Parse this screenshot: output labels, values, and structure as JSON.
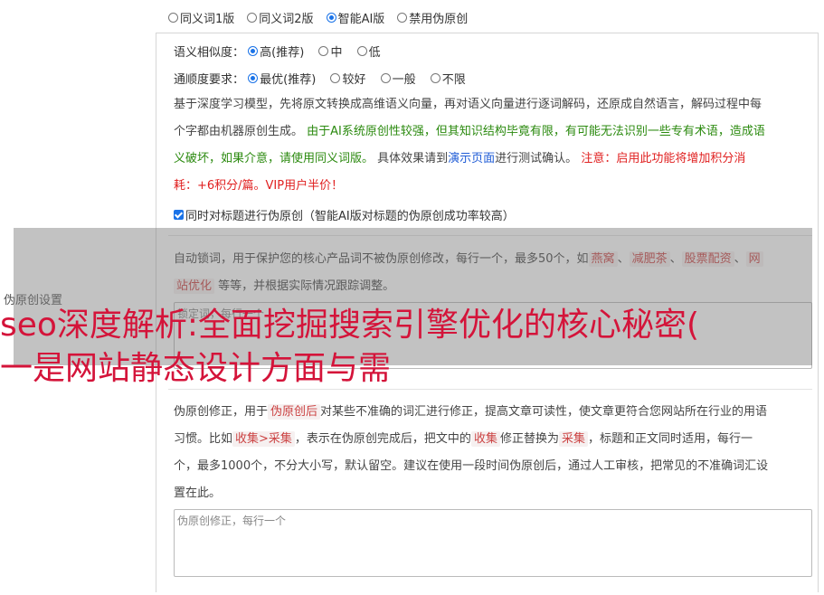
{
  "mode": {
    "options": [
      "同义词1版",
      "同义词2版",
      "智能AI版",
      "禁用伪原创"
    ],
    "selected": "智能AI版"
  },
  "similarity": {
    "label": "语义相似度：",
    "options": [
      "高(推荐)",
      "中",
      "低"
    ],
    "selected": "高(推荐)"
  },
  "fluency": {
    "label": "通顺度要求：",
    "options": [
      "最优(推荐)",
      "较好",
      "一般",
      "不限"
    ],
    "selected": "最优(推荐)"
  },
  "ai_desc": {
    "p1": "基于深度学习模型，先将原文转换成高维语义向量，再对语义向量进行逐词解码，还原成自然语言，解码过程中每",
    "p2a": "个字都由机器原创生成。 ",
    "p2b": "由于AI系统原创性较强，但其知识结构毕竟有限，有可能无法识别一些专有术语，造成语",
    "p3a": "义破坏，如果介意，请使用同义词版。",
    "p3b": " 具体效果请到",
    "p3c": "演示页面",
    "p3d": "进行测试确认。 ",
    "p3e": "注意：启用此功能将增加积分消",
    "p4": "耗：+6积分/篇。VIP用户半价！"
  },
  "title_check": {
    "label": "同时对标题进行伪原创（智能AI版对标题的伪原创成功率较高）",
    "checked": true
  },
  "lock_words": {
    "desc1": "自动锁词，用于保护您的核心产品词不被伪原创修改，每行一个，最多50个，如",
    "tags": [
      "燕窝",
      "减肥茶",
      "股票配资",
      "网"
    ],
    "desc2a": "站优化",
    "desc2b": " 等等，并根据实际情况跟踪调整。",
    "placeholder": "锁定词，每行一个"
  },
  "side_label": "伪原创设置",
  "correction": {
    "d1a": "伪原创修正，用于",
    "d1tag": "伪原创后",
    "d1b": "对某些不准确的词汇进行修正，提高文章可读性，使文章更符合您网站所在行业的用语",
    "d2a": "习惯。比如",
    "d2tag1": "收集>采集",
    "d2b": "，表示在伪原创完成后，把文中的",
    "d2tag2": "收集",
    "d2c": "修正替换为",
    "d2tag3": "采集",
    "d2d": "，标题和正文同时适用，每行一",
    "d3": "个，最多1000个，不分大小写，默认留空。建议在使用一段时间伪原创后，通过人工审核，把常见的不准确词汇设",
    "d4": "置在此。",
    "placeholder": "伪原创修正，每行一个"
  },
  "headline": {
    "line1": "seo深度解析:全面挖掘搜索引擎优化的核心秘密(",
    "line2": "一是网站静态设计方面与需"
  }
}
